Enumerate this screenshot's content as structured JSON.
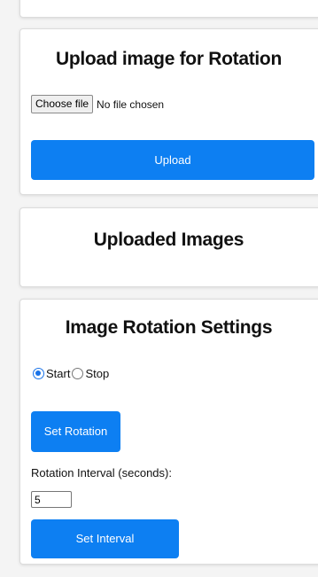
{
  "upload_section": {
    "title": "Upload image for Rotation",
    "choose_file_label": "Choose file",
    "file_status": "No file chosen",
    "upload_button": "Upload"
  },
  "uploaded_section": {
    "title": "Uploaded Images"
  },
  "settings_section": {
    "title": "Image Rotation Settings",
    "radio_start": "Start",
    "radio_stop": "Stop",
    "selected": "Start",
    "set_rotation_button": "Set Rotation",
    "interval_label": "Rotation Interval (seconds):",
    "interval_value": "5",
    "set_interval_button": "Set Interval"
  },
  "colors": {
    "primary": "#0d7ff2",
    "radio_accent": "#1a73e8"
  }
}
